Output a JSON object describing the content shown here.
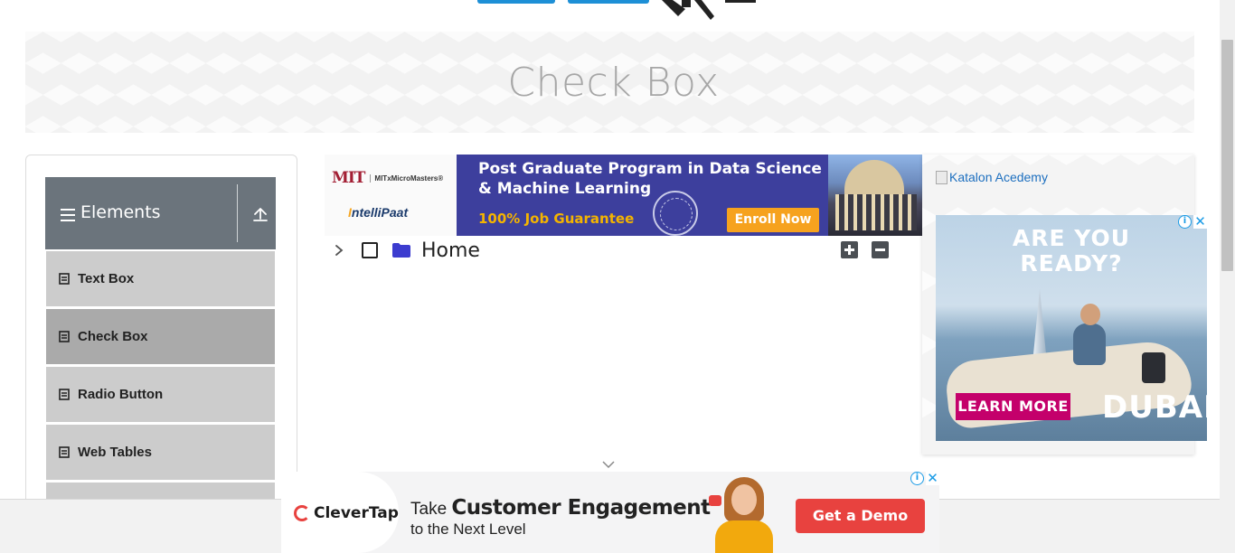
{
  "header": {
    "title": "Check Box"
  },
  "sidebar": {
    "group": {
      "label": "Elements",
      "icon": "hamburger-icon",
      "toggle_icon": "arrow-up-icon"
    },
    "items": [
      {
        "label": "Text Box",
        "active": false
      },
      {
        "label": "Check Box",
        "active": true
      },
      {
        "label": "Radio Button",
        "active": false
      },
      {
        "label": "Web Tables",
        "active": false
      }
    ]
  },
  "top_ad": {
    "mit_mark": "MIT",
    "mit_text": "MITxMicroMasters®",
    "intellipaat_i": "I",
    "intellipaat_rest": "ntelliPaat",
    "title": "Post Graduate Program in Data Science & Machine Learning",
    "guarantee": "100% Job Guarantee",
    "cta": "Enroll Now"
  },
  "tree": {
    "root_label": "Home",
    "checked": false,
    "expand_all_icon": "plus-icon",
    "collapse_all_icon": "minus-icon"
  },
  "right_ads": {
    "katalon_alt": "Katalon Acedemy",
    "dubai": {
      "headline_line1": "ARE YOU",
      "headline_line2": "READY?",
      "cta": "LEARN MORE",
      "brand": "DUBAI"
    }
  },
  "bottom_ad": {
    "brand": "CleverTap",
    "take": "Take ",
    "headline": "Customer Engagement",
    "subline": "to the Next Level",
    "cta": "Get a Demo"
  },
  "colors": {
    "sidebar_header": "#6b747c",
    "menu_item": "#cccccc",
    "menu_item_active": "#aaaaaa",
    "ad_blue": "#3d3f9d",
    "enroll_orange": "#f6a21e",
    "clevertap_red": "#e8423f",
    "dubai_pink": "#c4006b"
  }
}
